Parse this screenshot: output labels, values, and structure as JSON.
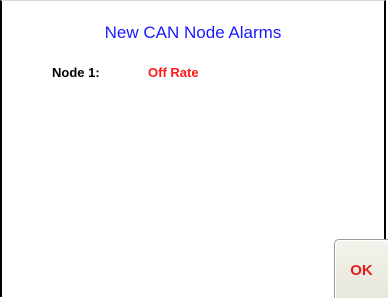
{
  "dialog": {
    "title": "New CAN Node Alarms",
    "alarms": [
      {
        "node_label": "Node 1:",
        "status": "Off Rate"
      }
    ],
    "ok_label": "OK"
  },
  "colors": {
    "title": "#1a1aff",
    "status": "#ff1a1a",
    "ok_label": "#e0201a",
    "label": "#000000",
    "border": "#000000"
  }
}
